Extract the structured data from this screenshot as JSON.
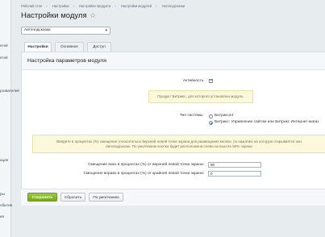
{
  "sidebar": {
    "items": [
      "ятей",
      "ятей",
      "рзователей",
      "ация",
      "ры",
      "обытия",
      "ия"
    ]
  },
  "breadcrumbs": [
    "Рабочий стол",
    "Настройки",
    "Настройки продукта",
    "Настройки модулей",
    "Автоподсказки"
  ],
  "page_title": "Настройки модуля",
  "module_select": {
    "value": "Автоподсказки"
  },
  "tabs": [
    "Настройки",
    "Основное",
    "Доступ"
  ],
  "panel": {
    "header": "Настройка параметров модуля",
    "active_label": "Активность:",
    "warning_text": "Продукт Битрикс, для которого установлен модуль.",
    "system_type_label": "Тип системы:",
    "radio_bitrix24": "Битрикс24",
    "radio_bitrix_cms": "Битрикс: Управление сайтом или Битрикс Интернет-магаз",
    "info_line1": "Введите в процентах (%) смещение относительно верхней левой точки экрана для размещения кнопки, по нажатию на которую открывается окн",
    "info_line2": "автоподсказок. По умолчанию кнопка будет расположена слева на высоте 50% экрана",
    "offset_down_label": "Смещение вниз в процентах (%) от верхней левой точки экрана:",
    "offset_down_value": "50",
    "offset_right_label": "Смещение вправо в процентах (%) от крайней левой точки экрана:",
    "offset_right_value": "0"
  },
  "footer": {
    "save": "Сохранить",
    "reset": "Сбросить",
    "default": "По умолчанию"
  }
}
